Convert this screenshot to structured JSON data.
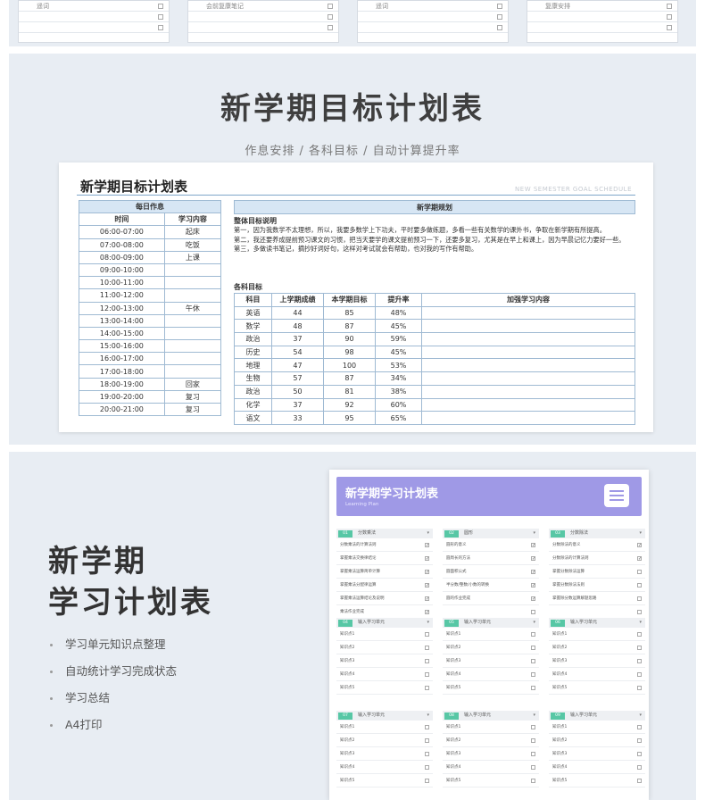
{
  "top_strip": {
    "sheets": [
      {
        "rows": [
          "遥词",
          "",
          ""
        ]
      },
      {
        "rows": [
          "会前复康笔记",
          "",
          ""
        ]
      },
      {
        "rows": [
          "遥词",
          "",
          ""
        ]
      },
      {
        "rows": [
          "复康安排",
          "",
          ""
        ]
      }
    ]
  },
  "panel1": {
    "title": "新学期目标计划表",
    "subtitle": "作息安排 / 各科目标 / 自动计算提升率",
    "sheet": {
      "title": "新学期目标计划表",
      "eng_title": "NEW SEMESTER GOAL SCHEDULE",
      "daily_header": "每日作息",
      "col_time": "时间",
      "col_content": "学习内容",
      "schedule": [
        {
          "time": "06:00-07:00",
          "content": "起床"
        },
        {
          "time": "07:00-08:00",
          "content": "吃饭"
        },
        {
          "time": "08:00-09:00",
          "content": "上课"
        },
        {
          "time": "09:00-10:00",
          "content": ""
        },
        {
          "time": "10:00-11:00",
          "content": ""
        },
        {
          "time": "11:00-12:00",
          "content": ""
        },
        {
          "time": "12:00-13:00",
          "content": "午休"
        },
        {
          "time": "13:00-14:00",
          "content": ""
        },
        {
          "time": "14:00-15:00",
          "content": ""
        },
        {
          "time": "15:00-16:00",
          "content": ""
        },
        {
          "time": "16:00-17:00",
          "content": ""
        },
        {
          "time": "17:00-18:00",
          "content": ""
        },
        {
          "time": "18:00-19:00",
          "content": "回家"
        },
        {
          "time": "19:00-20:00",
          "content": "复习"
        },
        {
          "time": "20:00-21:00",
          "content": "复习"
        }
      ],
      "plan_header": "新学期规划",
      "goal_label": "整体目标说明",
      "goal_lines": [
        "第一，因为我数学不太理想，所以，我要多数学上下功夫，平时要多做练题，多看一些有关数学的课外书，争取在新学期有所提高。",
        "第二，我还要养成提前预习课文的习惯，把当天要学的课文提前预习一下，还要多复习，尤其是在早上和课上，因为早晨记忆力要好一些。",
        "第三，多做读书笔记，摘抄好词好句，这样对考试就会有帮助，也对我的写作有帮助。"
      ],
      "subject_label": "各科目标",
      "subject_cols": [
        "科目",
        "上学期成绩",
        "本学期目标",
        "提升率",
        "加强学习内容"
      ],
      "subjects": [
        {
          "name": "英语",
          "last": "44",
          "target": "85",
          "rate": "48%"
        },
        {
          "name": "数学",
          "last": "48",
          "target": "87",
          "rate": "45%"
        },
        {
          "name": "政治",
          "last": "37",
          "target": "90",
          "rate": "59%"
        },
        {
          "name": "历史",
          "last": "54",
          "target": "98",
          "rate": "45%"
        },
        {
          "name": "地理",
          "last": "47",
          "target": "100",
          "rate": "53%"
        },
        {
          "name": "生物",
          "last": "57",
          "target": "87",
          "rate": "34%"
        },
        {
          "name": "政治",
          "last": "50",
          "target": "81",
          "rate": "38%"
        },
        {
          "name": "化学",
          "last": "37",
          "target": "92",
          "rate": "60%"
        },
        {
          "name": "语文",
          "last": "33",
          "target": "95",
          "rate": "65%"
        }
      ]
    }
  },
  "panel2": {
    "title_line1": "新学期",
    "title_line2": "学习计划表",
    "features": [
      "学习单元知识点整理",
      "自动统计学习完成状态",
      "学习总结",
      "A4打印"
    ],
    "app": {
      "title": "新学期学习计划表",
      "subtitle": "Learning Plan",
      "icon": "checklist-icon",
      "cards": [
        {
          "tag": "01",
          "name": "分数乘法",
          "rows": [
            "分数乘法的计算法则",
            "掌握乘法交换律结论",
            "掌握乘法运算简单计算",
            "掌握乘法分配律运算",
            "掌握乘法运算结论及说明",
            "乘法作业完成"
          ],
          "checks": [
            true,
            true,
            true,
            true,
            true,
            true
          ]
        },
        {
          "tag": "02",
          "name": "圆形",
          "rows": [
            "圆形的意义",
            "圆周长的方法",
            "圆面积公式",
            "半分数/整数/小数的转换",
            "圆的作业完成",
            ""
          ],
          "checks": [
            true,
            true,
            true,
            true,
            true,
            false
          ]
        },
        {
          "tag": "03",
          "name": "分数除法",
          "rows": [
            "分数除法的意义",
            "分数除法的计算法则",
            "掌握分数除法运算",
            "掌握分数除法法则",
            "掌握除分数运算解题思路",
            ""
          ],
          "checks": [
            true,
            true,
            false,
            false,
            false,
            false
          ]
        },
        {
          "tag": "04",
          "name": "输入学习单元",
          "rows": [
            "知识点1",
            "知识点2",
            "知识点3",
            "知识点4",
            "知识点5"
          ],
          "checks": [
            false,
            false,
            false,
            false,
            false
          ]
        },
        {
          "tag": "05",
          "name": "输入学习单元",
          "rows": [
            "知识点1",
            "知识点2",
            "知识点3",
            "知识点4",
            "知识点5"
          ],
          "checks": [
            false,
            false,
            false,
            false,
            false
          ]
        },
        {
          "tag": "06",
          "name": "输入学习单元",
          "rows": [
            "知识点1",
            "知识点2",
            "知识点3",
            "知识点4",
            "知识点5"
          ],
          "checks": [
            false,
            false,
            false,
            false,
            false
          ]
        },
        {
          "tag": "07",
          "name": "输入学习单元",
          "rows": [
            "知识点1",
            "知识点2",
            "知识点3",
            "知识点4",
            "知识点5"
          ],
          "checks": [
            false,
            false,
            false,
            false,
            false
          ]
        },
        {
          "tag": "08",
          "name": "输入学习单元",
          "rows": [
            "知识点1",
            "知识点2",
            "知识点3",
            "知识点4",
            "知识点5"
          ],
          "checks": [
            false,
            false,
            false,
            false,
            false
          ]
        },
        {
          "tag": "09",
          "name": "输入学习单元",
          "rows": [
            "知识点1",
            "知识点2",
            "知识点3",
            "知识点4",
            "知识点5"
          ],
          "checks": [
            false,
            false,
            false,
            false,
            false
          ]
        }
      ]
    }
  }
}
